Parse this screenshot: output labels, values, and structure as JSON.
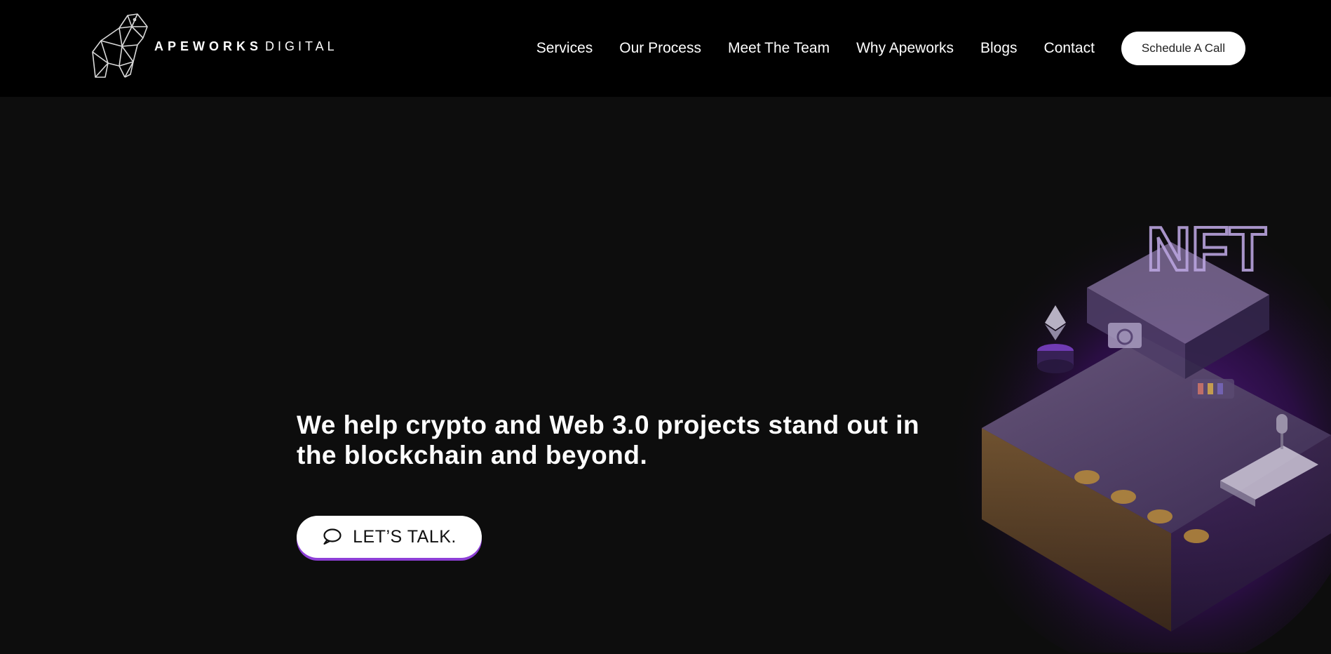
{
  "brand": {
    "name_bold": "APEWORKS",
    "name_light": "DIGITAL",
    "logo_icon": "geometric-bear-icon"
  },
  "nav": {
    "items": [
      {
        "label": "Services"
      },
      {
        "label": "Our Process"
      },
      {
        "label": "Meet The Team"
      },
      {
        "label": "Why Apeworks"
      },
      {
        "label": "Blogs"
      },
      {
        "label": "Contact"
      }
    ],
    "cta_label": "Schedule A Call"
  },
  "hero": {
    "headline": "We help crypto and Web 3.0 projects stand out in the blockchain and beyond.",
    "button_label": "LET’S TALK.",
    "button_icon": "chat-bubble-icon",
    "illustration": {
      "sign_text": "NFT",
      "icons": [
        "ethereum-icon",
        "microphone-icon",
        "keyboard-icon",
        "coin-icon"
      ]
    }
  },
  "colors": {
    "header_bg": "#000000",
    "page_bg": "#0d0d0d",
    "accent": "#8d3fd6",
    "text": "#ffffff"
  }
}
